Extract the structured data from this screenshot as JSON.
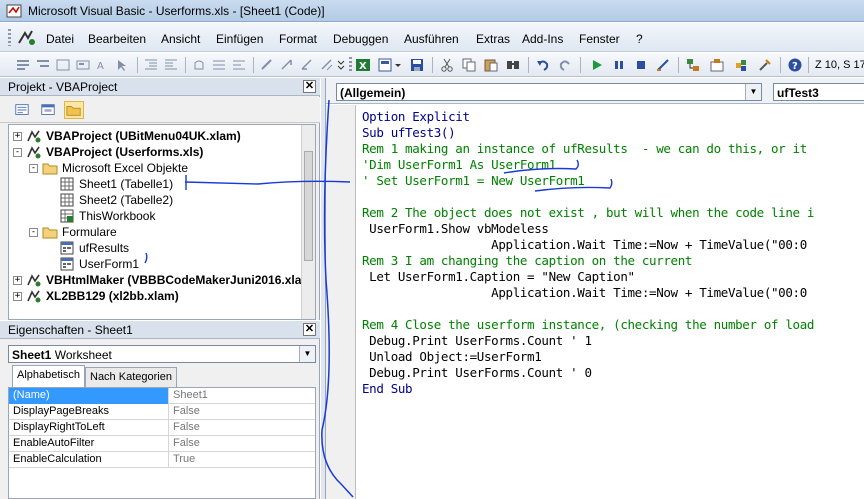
{
  "window": {
    "title": "Microsoft Visual Basic - Userforms.xls - [Sheet1 (Code)]"
  },
  "menu": {
    "items": [
      "Datei",
      "Bearbeiten",
      "Ansicht",
      "Einfügen",
      "Format",
      "Debuggen",
      "Ausführen",
      "Extras",
      "Add-Ins",
      "Fenster",
      "?"
    ]
  },
  "toolbar": {
    "position_text": "Z 10, S 17",
    "icons": [
      "excel-icon",
      "insert-icon",
      "save-icon",
      "cut-icon",
      "copy-icon",
      "paste-icon",
      "find-icon",
      "undo-icon",
      "redo-icon",
      "run-icon",
      "break-icon",
      "reset-icon",
      "design-mode-icon",
      "project-explorer-icon",
      "properties-icon",
      "object-browser-icon",
      "toolbox-icon",
      "help-icon"
    ]
  },
  "project_panel": {
    "title": "Projekt - VBAProject",
    "tree": [
      {
        "label": "VBAProject (UBitMenu04UK.xlam)",
        "bold": true,
        "level": 0,
        "expander": "+",
        "icon": "vba-project-icon"
      },
      {
        "label": "VBAProject (Userforms.xls)",
        "bold": true,
        "level": 0,
        "expander": "-",
        "icon": "vba-project-icon"
      },
      {
        "label": "Microsoft Excel Objekte",
        "bold": false,
        "level": 1,
        "expander": "-",
        "icon": "folder-icon"
      },
      {
        "label": "Sheet1 (Tabelle1)",
        "bold": false,
        "level": 2,
        "expander": "",
        "icon": "sheet-icon"
      },
      {
        "label": "Sheet2 (Tabelle2)",
        "bold": false,
        "level": 2,
        "expander": "",
        "icon": "sheet-icon"
      },
      {
        "label": "ThisWorkbook",
        "bold": false,
        "level": 2,
        "expander": "",
        "icon": "workbook-icon"
      },
      {
        "label": "Formulare",
        "bold": false,
        "level": 1,
        "expander": "-",
        "icon": "folder-icon"
      },
      {
        "label": "ufResults",
        "bold": false,
        "level": 2,
        "expander": "",
        "icon": "userform-icon"
      },
      {
        "label": "UserForm1",
        "bold": false,
        "level": 2,
        "expander": "",
        "icon": "userform-icon"
      },
      {
        "label": "VBHtmlMaker (VBBBCodeMakerJuni2016.xla",
        "bold": true,
        "level": 0,
        "expander": "+",
        "icon": "vba-project-icon"
      },
      {
        "label": "XL2BB129 (xl2bb.xlam)",
        "bold": true,
        "level": 0,
        "expander": "+",
        "icon": "vba-project-icon"
      }
    ]
  },
  "properties_panel": {
    "title": "Eigenschaften - Sheet1",
    "object_name": "Sheet1",
    "object_type": "Worksheet",
    "tabs": [
      "Alphabetisch",
      "Nach Kategorien"
    ],
    "rows": [
      {
        "name": "(Name)",
        "value": "Sheet1"
      },
      {
        "name": "DisplayPageBreaks",
        "value": "False"
      },
      {
        "name": "DisplayRightToLeft",
        "value": "False"
      },
      {
        "name": "EnableAutoFilter",
        "value": "False"
      },
      {
        "name": "EnableCalculation",
        "value": "True"
      }
    ]
  },
  "code_window": {
    "object_combo": "(Allgemein)",
    "procedure_combo": "ufTest3",
    "lines": [
      {
        "kind": "kw",
        "text": "Option Explicit"
      },
      {
        "kind": "kw",
        "text": "Sub ufTest3()"
      },
      {
        "kind": "cm",
        "text": "Rem 1 making an instance of ufResults  - we can do this, or it"
      },
      {
        "kind": "cm",
        "text": "'Dim UserForm1 As UserForm1"
      },
      {
        "kind": "cm",
        "text": "' Set UserForm1 = New UserForm1"
      },
      {
        "kind": "tx",
        "text": ""
      },
      {
        "kind": "cm",
        "text": "Rem 2 The object does not exist , but will when the code line i"
      },
      {
        "kind": "tx",
        "text": " UserForm1.Show vbModeless"
      },
      {
        "kind": "tx",
        "text": "                  Application.Wait Time:=Now + TimeValue(\"00:0"
      },
      {
        "kind": "cm",
        "text": "Rem 3 I am changing the caption on the current"
      },
      {
        "kind": "tx",
        "text": " Let UserForm1.Caption = \"New Caption\""
      },
      {
        "kind": "tx",
        "text": "                  Application.Wait Time:=Now + TimeValue(\"00:0"
      },
      {
        "kind": "tx",
        "text": ""
      },
      {
        "kind": "cm",
        "text": "Rem 4 Close the userform instance, (checking the number of load"
      },
      {
        "kind": "tx",
        "text": " Debug.Print UserForms.Count ' 1"
      },
      {
        "kind": "tx",
        "text": " Unload Object:=UserForm1"
      },
      {
        "kind": "tx",
        "text": " Debug.Print UserForms.Count ' 0"
      },
      {
        "kind": "kw",
        "text": "End Sub"
      }
    ]
  },
  "colors": {
    "keyword": "#00008b",
    "comment": "#008000",
    "annotation": "#1a3ad6",
    "selection": "#3399ff"
  }
}
